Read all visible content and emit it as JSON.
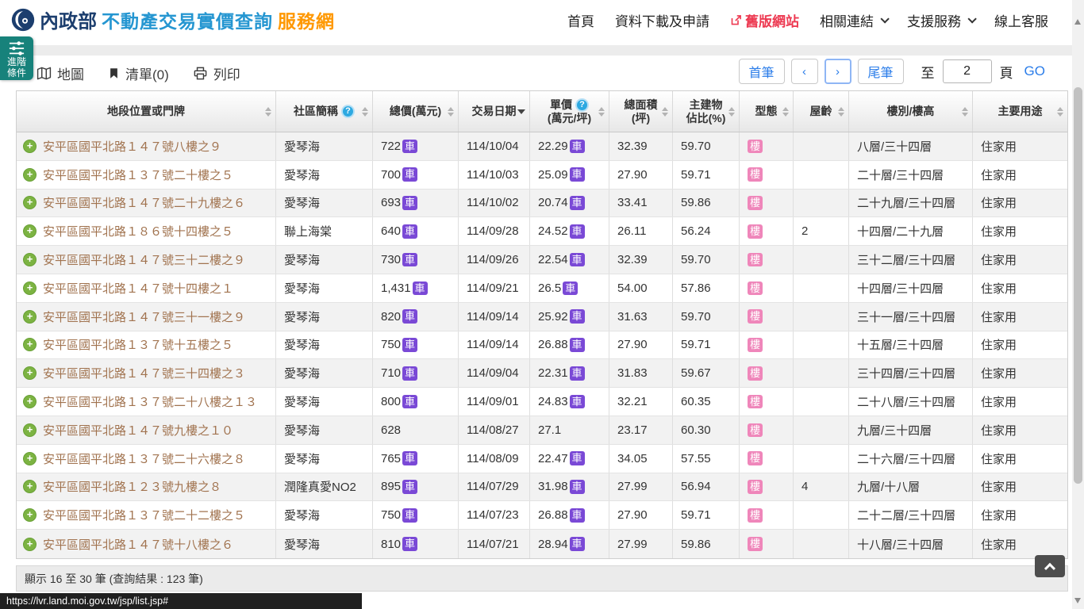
{
  "header": {
    "brand": {
      "agency": "內政部",
      "title_blue": "不動產交易實價查詢",
      "title_orange": "服務網"
    },
    "nav": [
      {
        "label": "首頁"
      },
      {
        "label": "資料下載及申請"
      },
      {
        "label": "舊版網站"
      },
      {
        "label": "相關連結"
      },
      {
        "label": "支援服務"
      },
      {
        "label": "線上客服"
      }
    ]
  },
  "advanced_tab": {
    "line1": "進階",
    "line2": "條件"
  },
  "toolbar": {
    "map_label": "地圖",
    "list_label": "清單(0)",
    "print_label": "列印",
    "pagination": {
      "first_label": "首筆",
      "prev_label": "‹",
      "next_label": "›",
      "last_label": "尾筆",
      "goto_prefix": "至",
      "page_value": "2",
      "goto_suffix": "頁",
      "go_label": "GO"
    }
  },
  "table": {
    "columns": [
      {
        "line1": "地段位置或門牌",
        "line2": "",
        "help": false,
        "sort": "both"
      },
      {
        "line1": "社區簡稱",
        "line2": "",
        "help": true,
        "sort": "both"
      },
      {
        "line1": "總價(萬元)",
        "line2": "",
        "help": false,
        "sort": "both"
      },
      {
        "line1": "交易日期",
        "line2": "",
        "help": false,
        "sort": "desc"
      },
      {
        "line1": "單價",
        "line2": "(萬元/坪)",
        "help": true,
        "sort": "both"
      },
      {
        "line1": "總面積",
        "line2": "(坪)",
        "help": false,
        "sort": "both"
      },
      {
        "line1": "主建物",
        "line2": "佔比(%)",
        "help": false,
        "sort": "both"
      },
      {
        "line1": "型態",
        "line2": "",
        "help": false,
        "sort": "both"
      },
      {
        "line1": "屋齡",
        "line2": "",
        "help": false,
        "sort": "both"
      },
      {
        "line1": "樓別/樓高",
        "line2": "",
        "help": false,
        "sort": "both"
      },
      {
        "line1": "主要用途",
        "line2": "",
        "help": false,
        "sort": "both"
      }
    ],
    "badge_car": "車",
    "rows": [
      {
        "address": "安平區國平北路１４７號八樓之９",
        "community": "愛琴海",
        "price": "722",
        "price_car": true,
        "date": "114/10/04",
        "unit_price": "22.29",
        "unit_car": true,
        "area": "32.39",
        "ratio": "59.70",
        "type": "樓",
        "age": "",
        "floor": "八層/三十四層",
        "usage": "住家用"
      },
      {
        "address": "安平區國平北路１３７號二十樓之５",
        "community": "愛琴海",
        "price": "700",
        "price_car": true,
        "date": "114/10/03",
        "unit_price": "25.09",
        "unit_car": true,
        "area": "27.90",
        "ratio": "59.71",
        "type": "樓",
        "age": "",
        "floor": "二十層/三十四層",
        "usage": "住家用"
      },
      {
        "address": "安平區國平北路１４７號二十九樓之６",
        "community": "愛琴海",
        "price": "693",
        "price_car": true,
        "date": "114/10/02",
        "unit_price": "20.74",
        "unit_car": true,
        "area": "33.41",
        "ratio": "59.86",
        "type": "樓",
        "age": "",
        "floor": "二十九層/三十四層",
        "usage": "住家用"
      },
      {
        "address": "安平區國平北路１８６號十四樓之５",
        "community": "聯上海棠",
        "price": "640",
        "price_car": true,
        "date": "114/09/28",
        "unit_price": "24.52",
        "unit_car": true,
        "area": "26.11",
        "ratio": "56.24",
        "type": "樓",
        "age": "2",
        "floor": "十四層/二十九層",
        "usage": "住家用"
      },
      {
        "address": "安平區國平北路１４７號三十二樓之９",
        "community": "愛琴海",
        "price": "730",
        "price_car": true,
        "date": "114/09/26",
        "unit_price": "22.54",
        "unit_car": true,
        "area": "32.39",
        "ratio": "59.70",
        "type": "樓",
        "age": "",
        "floor": "三十二層/三十四層",
        "usage": "住家用"
      },
      {
        "address": "安平區國平北路１４７號十四樓之１",
        "community": "愛琴海",
        "price": "1,431",
        "price_car": true,
        "date": "114/09/21",
        "unit_price": "26.5",
        "unit_car": true,
        "area": "54.00",
        "ratio": "57.86",
        "type": "樓",
        "age": "",
        "floor": "十四層/三十四層",
        "usage": "住家用"
      },
      {
        "address": "安平區國平北路１４７號三十一樓之９",
        "community": "愛琴海",
        "price": "820",
        "price_car": true,
        "date": "114/09/14",
        "unit_price": "25.92",
        "unit_car": true,
        "area": "31.63",
        "ratio": "59.70",
        "type": "樓",
        "age": "",
        "floor": "三十一層/三十四層",
        "usage": "住家用"
      },
      {
        "address": "安平區國平北路１３７號十五樓之５",
        "community": "愛琴海",
        "price": "750",
        "price_car": true,
        "date": "114/09/14",
        "unit_price": "26.88",
        "unit_car": true,
        "area": "27.90",
        "ratio": "59.71",
        "type": "樓",
        "age": "",
        "floor": "十五層/三十四層",
        "usage": "住家用"
      },
      {
        "address": "安平區國平北路１４７號三十四樓之３",
        "community": "愛琴海",
        "price": "710",
        "price_car": true,
        "date": "114/09/04",
        "unit_price": "22.31",
        "unit_car": true,
        "area": "31.83",
        "ratio": "59.67",
        "type": "樓",
        "age": "",
        "floor": "三十四層/三十四層",
        "usage": "住家用"
      },
      {
        "address": "安平區國平北路１３７號二十八樓之１３",
        "community": "愛琴海",
        "price": "800",
        "price_car": true,
        "date": "114/09/01",
        "unit_price": "24.83",
        "unit_car": true,
        "area": "32.21",
        "ratio": "60.35",
        "type": "樓",
        "age": "",
        "floor": "二十八層/三十四層",
        "usage": "住家用"
      },
      {
        "address": "安平區國平北路１４７號九樓之１０",
        "community": "愛琴海",
        "price": "628",
        "price_car": false,
        "date": "114/08/27",
        "unit_price": "27.1",
        "unit_car": false,
        "area": "23.17",
        "ratio": "60.30",
        "type": "樓",
        "age": "",
        "floor": "九層/三十四層",
        "usage": "住家用"
      },
      {
        "address": "安平區國平北路１３７號二十六樓之８",
        "community": "愛琴海",
        "price": "765",
        "price_car": true,
        "date": "114/08/09",
        "unit_price": "22.47",
        "unit_car": true,
        "area": "34.05",
        "ratio": "57.55",
        "type": "樓",
        "age": "",
        "floor": "二十六層/三十四層",
        "usage": "住家用"
      },
      {
        "address": "安平區國平北路１２３號九樓之８",
        "community": "潤隆真愛NO2",
        "price": "895",
        "price_car": true,
        "date": "114/07/29",
        "unit_price": "31.98",
        "unit_car": true,
        "area": "27.99",
        "ratio": "56.94",
        "type": "樓",
        "age": "4",
        "floor": "九層/十八層",
        "usage": "住家用"
      },
      {
        "address": "安平區國平北路１３７號二十二樓之５",
        "community": "愛琴海",
        "price": "750",
        "price_car": true,
        "date": "114/07/23",
        "unit_price": "26.88",
        "unit_car": true,
        "area": "27.90",
        "ratio": "59.71",
        "type": "樓",
        "age": "",
        "floor": "二十二層/三十四層",
        "usage": "住家用"
      },
      {
        "address": "安平區國平北路１４７號十八樓之６",
        "community": "愛琴海",
        "price": "810",
        "price_car": true,
        "date": "114/07/21",
        "unit_price": "28.94",
        "unit_car": true,
        "area": "27.99",
        "ratio": "59.86",
        "type": "樓",
        "age": "",
        "floor": "十八層/三十四層",
        "usage": "住家用"
      }
    ],
    "summary": "顯示 16 至 30 筆 (查詢結果 : 123 筆)"
  },
  "status_url": "https://lvr.land.moi.gov.tw/jsp/list.jsp#",
  "colors": {
    "teal": "#17827b",
    "brand_blue": "#2596d1",
    "brand_orange": "#ff9800",
    "brand_navy": "#1c3e6e",
    "nav_red": "#ed3a52",
    "link_blue": "#2b7de9",
    "badge_car_purple": "#7a49d6",
    "badge_building_pink": "#ef86ba",
    "address_brown": "#a1734f",
    "plus_green": "#7cb342"
  }
}
